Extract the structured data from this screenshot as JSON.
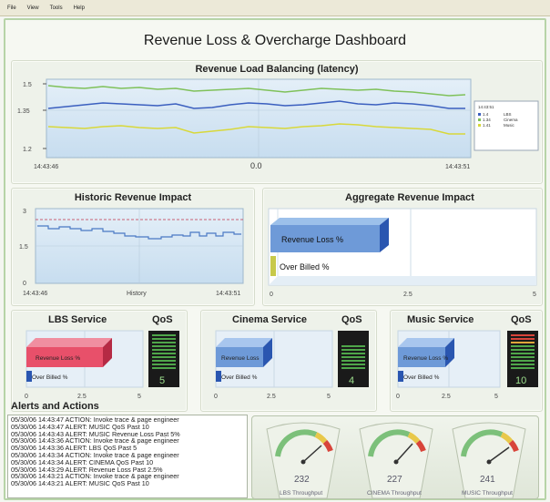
{
  "menu": [
    "File",
    "View",
    "Tools",
    "Help"
  ],
  "dashboard_title": "Revenue Loss & Overcharge Dashboard",
  "latency": {
    "title": "Revenue Load Balancing (latency)",
    "y_ticks": [
      "1.5",
      "1.35",
      "1.2"
    ],
    "x_start": "14:43:46",
    "x_mid": "0.0",
    "x_end": "14:43:51",
    "legend_time": "14:43:51",
    "legend": [
      {
        "value": "1.4",
        "label": "LBS",
        "color": "#3b5fbf"
      },
      {
        "value": "1.34",
        "label": "Cinema",
        "color": "#7fc15a"
      },
      {
        "value": "1.41",
        "label": "Music",
        "color": "#d8d83a"
      }
    ]
  },
  "historic": {
    "title": "Historic Revenue Impact",
    "y_ticks": [
      "3",
      "1.5",
      "0"
    ],
    "x_start": "14:43:46",
    "x_mid": "History",
    "x_end": "14:43:51"
  },
  "aggregate": {
    "title": "Aggregate Revenue Impact",
    "bar1": "Revenue Loss %",
    "bar2": "Over Billed %",
    "ticks": [
      "0",
      "2.5",
      "5"
    ]
  },
  "services": [
    {
      "title": "LBS Service",
      "qos_label": "QoS",
      "qos_value": "5",
      "bar1": "Revenue Loss %",
      "bar2": "Over Billed %",
      "ticks": [
        "0",
        "2.5",
        "5"
      ],
      "bar_color": "#e8506a"
    },
    {
      "title": "Cinema Service",
      "qos_label": "QoS",
      "qos_value": "4",
      "bar1": "Revenue Loss",
      "bar2": "Over Billed %",
      "ticks": [
        "0",
        "2.5",
        "5"
      ],
      "bar_color": "#6e9ad8"
    },
    {
      "title": "Music Service",
      "qos_label": "QoS",
      "qos_value": "10",
      "bar1": "Revenue Loss %",
      "bar2": "Over Billed %",
      "ticks": [
        "0",
        "2.5",
        "5"
      ],
      "bar_color": "#6e9ad8"
    }
  ],
  "alerts_title": "Alerts and Actions",
  "alerts": [
    "05/30/06 14:43:47  ACTION: Invoke trace & page engineer",
    "05/30/06 14:43:47  ALERT: MUSIC QoS Past 10",
    "05/30/06 14:43:43  ALERT: MUSIC Revenue Loss Past 5%",
    "05/30/06 14:43:36  ACTION: Invoke trace & page engineer",
    "05/30/06 14:43:36  ALERT: LBS QoS Past 5",
    "05/30/06 14:43:34  ACTION: Invoke trace & page engineer",
    "05/30/06 14:43:34  ALERT: CINEMA QoS Past 10",
    "05/30/06 14:43:29  ALERT: Revenue Loss Past 2.5%",
    "05/30/06 14:43:21  ACTION: Invoke trace & page engineer",
    "05/30/06 14:43:21  ALERT: MUSIC QoS Past 10"
  ],
  "gauges": [
    {
      "value": "232",
      "label": "LBS Throughput"
    },
    {
      "value": "227",
      "label": "CINEMA Throughput"
    },
    {
      "value": "241",
      "label": "MUSIC Throughput"
    }
  ]
}
